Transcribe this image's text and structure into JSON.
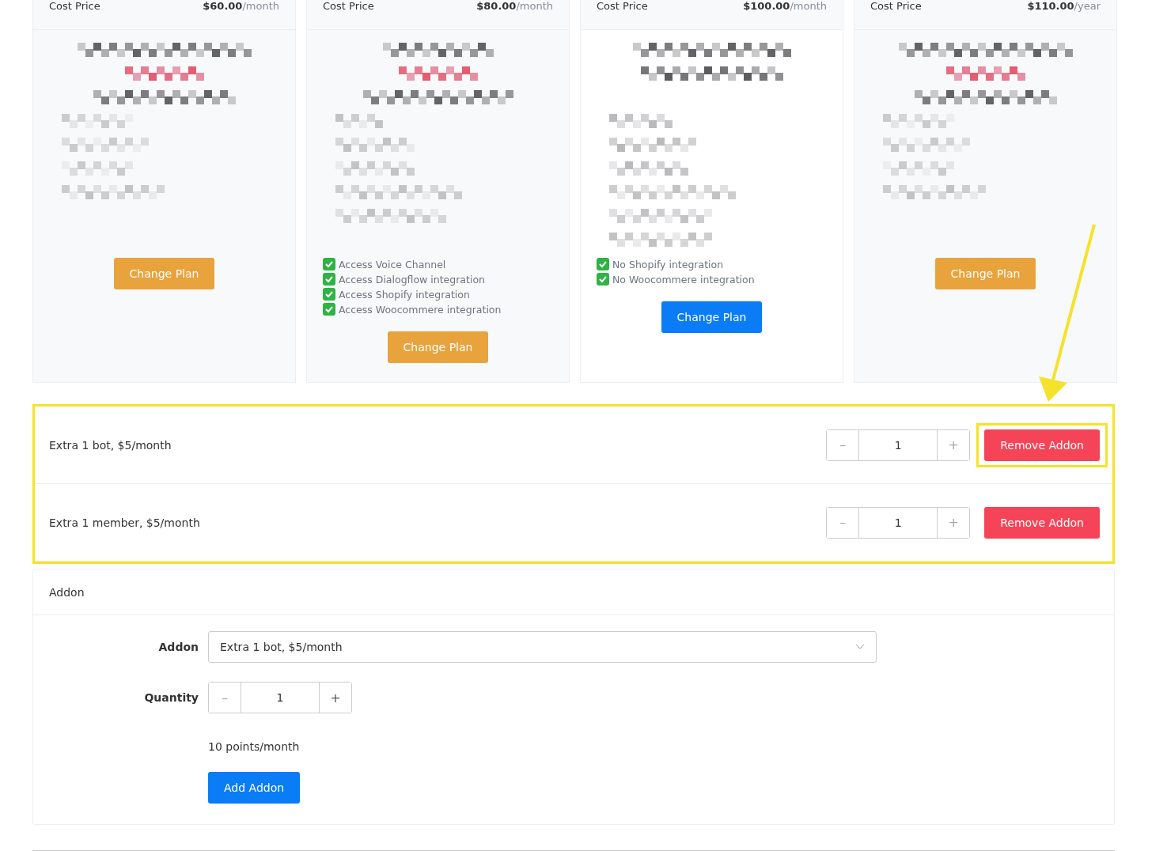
{
  "plans": [
    {
      "cost_label": "Cost Price",
      "price": "$60.00",
      "period": "/month",
      "button": "Change Plan",
      "selected": false
    },
    {
      "cost_label": "Cost Price",
      "price": "$80.00",
      "period": "/month",
      "features": [
        {
          "text": "Access Voice Channel",
          "checked": true
        },
        {
          "text": "Access Dialogflow integration",
          "checked": true
        },
        {
          "text": "Access Shopify integration",
          "checked": true
        },
        {
          "text": "Access Woocommere integration",
          "checked": true
        }
      ],
      "button": "Change Plan",
      "selected": false
    },
    {
      "cost_label": "Cost Price",
      "price": "$100.00",
      "period": "/month",
      "features": [
        {
          "text": "No Shopify integration",
          "checked": true
        },
        {
          "text": "No Woocommere integration",
          "checked": true
        }
      ],
      "button": "Change Plan",
      "selected": true
    },
    {
      "cost_label": "Cost Price",
      "price": "$110.00",
      "period": "/year",
      "button": "Change Plan",
      "selected": false
    }
  ],
  "addons": [
    {
      "name": "Extra 1 bot, $5/month",
      "quantity": "1",
      "minus": "–",
      "plus": "+",
      "button": "Remove Addon",
      "highlighted": true
    },
    {
      "name": "Extra 1 member, $5/month",
      "quantity": "1",
      "minus": "–",
      "plus": "+",
      "button": "Remove Addon",
      "highlighted": false
    }
  ],
  "addon_form": {
    "title": "Addon",
    "addon_label": "Addon",
    "addon_value": "Extra 1 bot, $5/month",
    "quantity_label": "Quantity",
    "quantity": "1",
    "minus": "–",
    "plus": "+",
    "note": "10 points/month",
    "submit": "Add Addon"
  }
}
